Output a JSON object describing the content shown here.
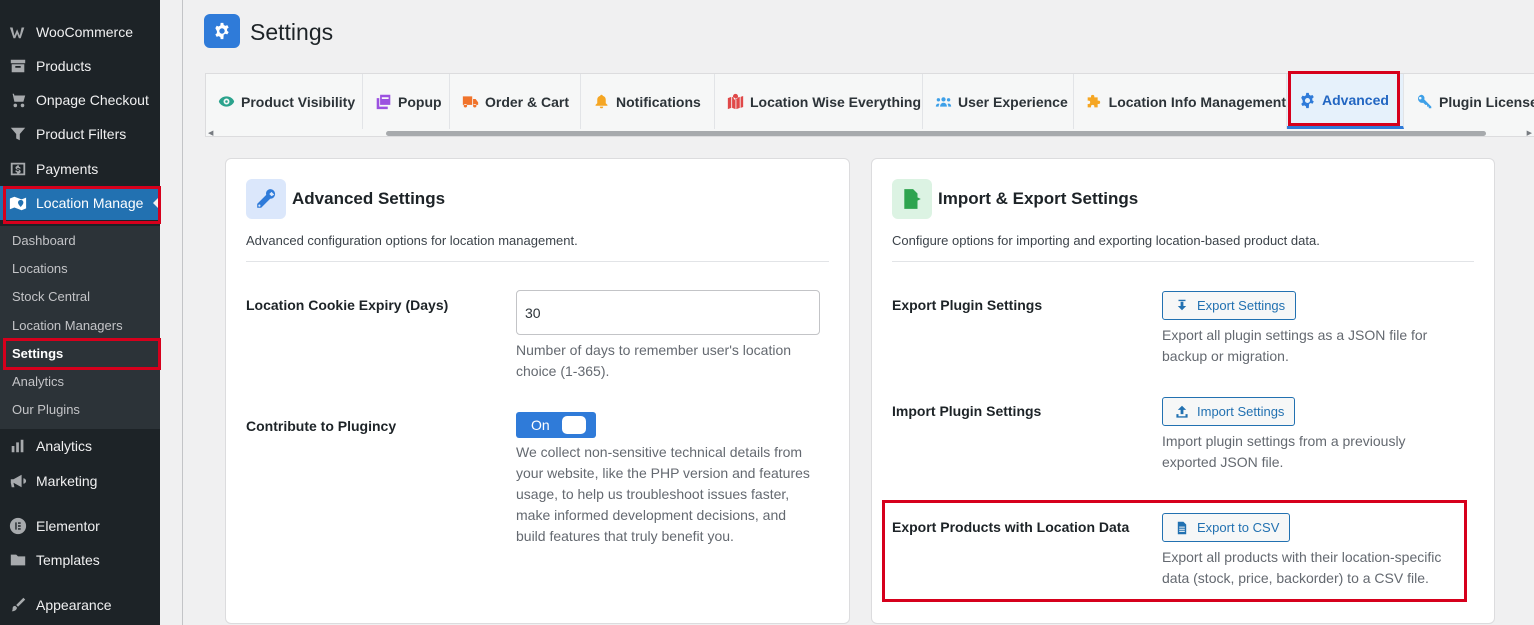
{
  "sidebar": {
    "top_items": [
      {
        "label": "WooCommerce",
        "icon": "woocommerce-icon"
      },
      {
        "label": "Products",
        "icon": "archive-icon"
      },
      {
        "label": "Onpage Checkout",
        "icon": "cart-icon"
      },
      {
        "label": "Product Filters",
        "icon": "filter-icon"
      },
      {
        "label": "Payments",
        "icon": "dollar-icon"
      },
      {
        "label": "Location Manage",
        "icon": "map-icon"
      }
    ],
    "submenu": [
      "Dashboard",
      "Locations",
      "Stock Central",
      "Location Managers",
      "Settings",
      "Analytics",
      "Our Plugins"
    ],
    "bottom_items": [
      {
        "label": "Analytics",
        "icon": "chart-bar-icon"
      },
      {
        "label": "Marketing",
        "icon": "megaphone-icon"
      },
      {
        "label": "Elementor",
        "icon": "elementor-icon"
      },
      {
        "label": "Templates",
        "icon": "folder-icon"
      },
      {
        "label": "Appearance",
        "icon": "paintbrush-icon"
      }
    ]
  },
  "header": {
    "title": "Settings",
    "icon": "gear-icon"
  },
  "tabs": [
    {
      "label": "Product Visibility",
      "icon": "eye-icon",
      "color": "#2ba38d"
    },
    {
      "label": "Popup",
      "icon": "window-icon",
      "color": "#9b51e0"
    },
    {
      "label": "Order & Cart",
      "icon": "truck-icon",
      "color": "#f0732b"
    },
    {
      "label": "Notifications",
      "icon": "bell-icon",
      "color": "#f5a623"
    },
    {
      "label": "Location Wise Everything",
      "icon": "map-marked-icon",
      "color": "#e04848"
    },
    {
      "label": "User Experience",
      "icon": "users-icon",
      "color": "#3ea0e8"
    },
    {
      "label": "Location Info Management",
      "icon": "puzzle-icon",
      "color": "#f5a623"
    },
    {
      "label": "Advanced",
      "icon": "gear-icon",
      "color": "#2f7bd9"
    },
    {
      "label": "Plugin License",
      "icon": "key-icon",
      "color": "#3ea0e8"
    }
  ],
  "advanced_card": {
    "title": "Advanced Settings",
    "description": "Advanced configuration options for location management.",
    "cookie_label": "Location Cookie Expiry (Days)",
    "cookie_value": "30",
    "cookie_help_1": "Number of days to remember user's location",
    "cookie_help_2": "choice (1-365).",
    "contribute_label": "Contribute to Plugincy",
    "toggle_label": "On",
    "contribute_help": [
      "We collect non-sensitive technical details from",
      "your website, like the PHP version and features",
      "usage, to help us troubleshoot issues faster,",
      "make informed development decisions, and",
      "build features that truly benefit you."
    ]
  },
  "import_export_card": {
    "title": "Import & Export Settings",
    "description": "Configure options for importing and exporting location-based product data.",
    "export_settings_label": "Export Plugin Settings",
    "export_settings_button": "Export Settings",
    "export_settings_help_1": "Export all plugin settings as a JSON file for",
    "export_settings_help_2": "backup or migration.",
    "import_settings_label": "Import Plugin Settings",
    "import_settings_button": "Import Settings",
    "import_settings_help_1": "Import plugin settings from a previously",
    "import_settings_help_2": "exported JSON file.",
    "export_products_label": "Export Products with Location Data",
    "export_products_button": "Export to CSV",
    "export_products_help_1": "Export all products with their location-specific",
    "export_products_help_2": "data (stock, price, backorder) to a CSV file."
  },
  "colors": {
    "accent": "#2f7bd9",
    "highlight_box": "#d6001c",
    "sidebar_bg": "#1d2327"
  }
}
